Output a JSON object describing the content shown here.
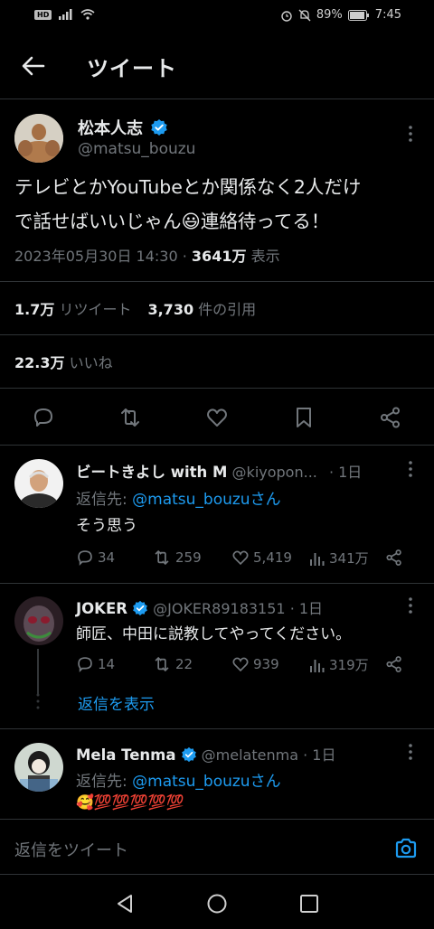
{
  "status_bar": {
    "hd": "HD",
    "battery": "89%",
    "time": "7:45"
  },
  "header": {
    "title": "ツイート"
  },
  "tweet": {
    "author_name": "松本人志",
    "handle": "@matsu_bouzu",
    "text_line1": "テレビとかYouTubeとか関係なく2人だけ",
    "text_line2_a": "で話せばいいじゃん",
    "text_line2_b": "連絡待ってる！",
    "emoji": "😃",
    "datetime": "2023年05月30日 14:30",
    "separator": "·",
    "views_count": "3641万",
    "views_label": "表示",
    "retweets_count": "1.7万",
    "retweets_label": "リツイート",
    "quotes_count": "3,730",
    "quotes_label": "件の引用",
    "likes_count": "22.3万",
    "likes_label": "いいね"
  },
  "replies": [
    {
      "name": "ビートきよし with M",
      "handle": "@kiyopon...",
      "time": "· 1日",
      "reply_to_label": "返信先: ",
      "reply_to_handle": "@matsu_bouzu",
      "reply_to_suffix": "さん",
      "text": "そう思う",
      "replies": "34",
      "retweets": "259",
      "likes": "5,419",
      "views": "341万"
    },
    {
      "name": "JOKER",
      "handle": "@JOKER89183151",
      "time": "· 1日",
      "text": "師匠、中田に説教してやってください。",
      "replies": "14",
      "retweets": "22",
      "likes": "939",
      "views": "319万",
      "show_replies": "返信を表示"
    },
    {
      "name": "Mela Tenma",
      "handle": "@melatenma",
      "time": "· 1日",
      "reply_to_label": "返信先: ",
      "reply_to_handle": "@matsu_bouzu",
      "reply_to_suffix": "さん",
      "text": "🥰💯💯💯💯💯"
    }
  ],
  "compose": {
    "placeholder": "返信をツイート"
  },
  "colors": {
    "accent": "#1d9bf0",
    "background": "#000000",
    "muted": "#71767b",
    "divider": "#2f3336"
  }
}
